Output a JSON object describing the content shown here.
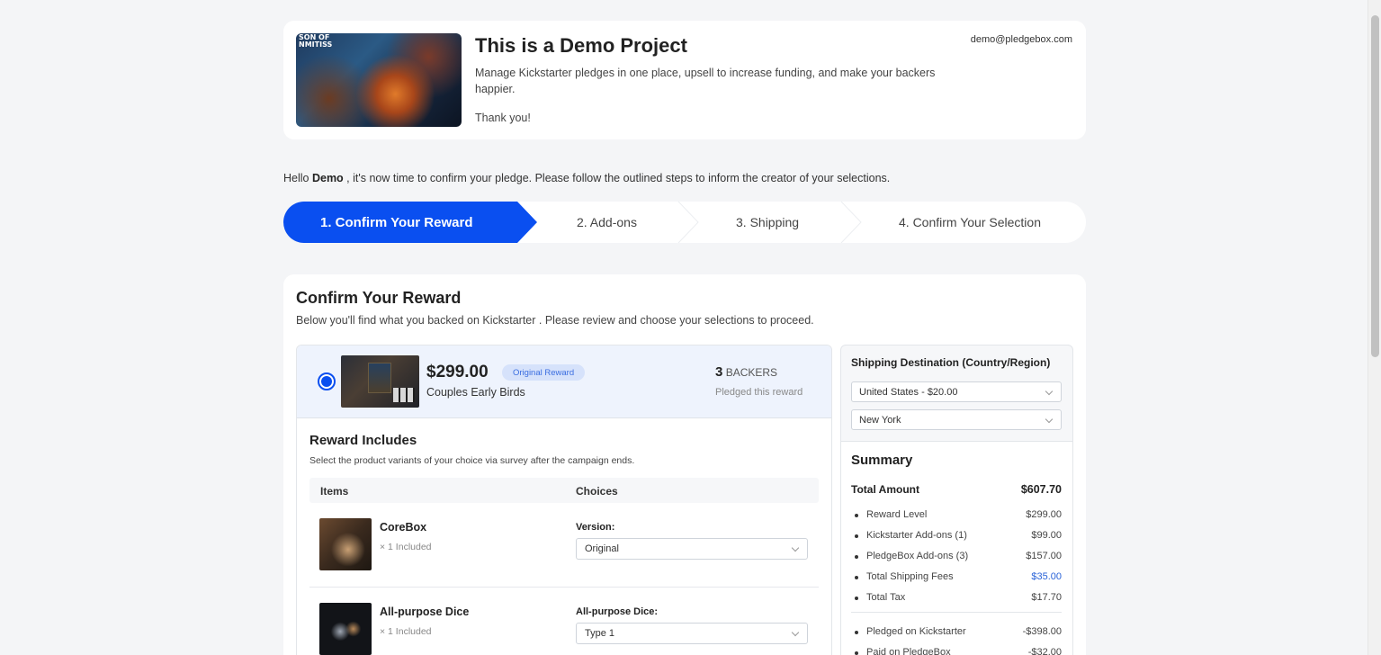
{
  "project": {
    "title": "This is a Demo Project",
    "description": "Manage Kickstarter pledges in one place, upsell to increase funding, and make your backers happier.",
    "thanks": "Thank you!",
    "email": "demo@pledgebox.com",
    "image_text_line1": "SON OF",
    "image_text_line2": "NMITISS"
  },
  "greeting": {
    "prefix": "Hello ",
    "name": "Demo",
    "suffix": " , it's now time to confirm your pledge. Please follow the outlined steps to inform the creator of your selections."
  },
  "steps": [
    {
      "label": "1. Confirm Your Reward",
      "active": true
    },
    {
      "label": "2. Add-ons",
      "active": false
    },
    {
      "label": "3. Shipping",
      "active": false
    },
    {
      "label": "4. Confirm Your Selection",
      "active": false
    }
  ],
  "reward_section": {
    "title": "Confirm Your Reward",
    "subtitle": "Below you'll find what you backed on Kickstarter . Please review and choose your selections to proceed."
  },
  "reward": {
    "price": "$299.00",
    "badge": "Original Reward",
    "name": "Couples Early Birds",
    "backers_count": "3",
    "backers_label": "BACKERS",
    "backers_sub": "Pledged this reward",
    "selected": true
  },
  "includes": {
    "title": "Reward Includes",
    "subtitle": "Select the product variants of your choice via survey after the campaign ends.",
    "col_items": "Items",
    "col_choices": "Choices",
    "items": [
      {
        "name": "CoreBox",
        "qty": "× 1 Included",
        "choice_label": "Version:",
        "choice_value": "Original"
      },
      {
        "name": "All-purpose Dice",
        "qty": "× 1 Included",
        "choice_label": "All-purpose Dice:",
        "choice_value": "Type 1"
      }
    ]
  },
  "shipping": {
    "title": "Shipping Destination (Country/Region)",
    "country": "United States - $20.00",
    "region": "New York"
  },
  "summary": {
    "title": "Summary",
    "total_label": "Total Amount",
    "total_value": "$607.70",
    "lines": [
      {
        "label": "Reward Level",
        "value": "$299.00"
      },
      {
        "label": "Kickstarter Add-ons (1)",
        "value": "$99.00"
      },
      {
        "label": "PledgeBox Add-ons (3)",
        "value": "$157.00"
      },
      {
        "label": "Total Shipping Fees",
        "value": "$35.00"
      },
      {
        "label": "Total Tax",
        "value": "$17.70"
      }
    ],
    "payments": [
      {
        "label": "Pledged on Kickstarter",
        "value": "-$398.00"
      },
      {
        "label": "Paid on PledgeBox",
        "value": "-$32.00"
      }
    ]
  },
  "colors": {
    "accent": "#0a4ff0",
    "link": "#2a63d8",
    "badge_bg": "#d6e2fb",
    "selected_row_bg": "#eef3fd"
  }
}
